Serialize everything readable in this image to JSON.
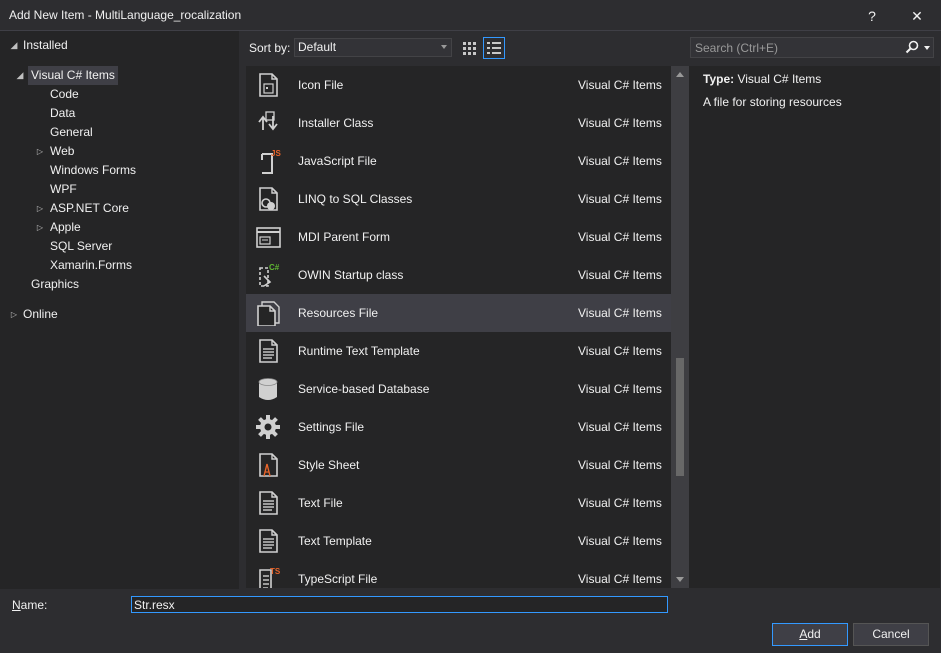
{
  "window": {
    "title": "Add New Item - MultiLanguage_rocalization",
    "help_label": "?",
    "close_label": "✕"
  },
  "tree": {
    "installed": "Installed",
    "visual_cs_items": "Visual C# Items",
    "children": [
      "Code",
      "Data",
      "General",
      "Web",
      "Windows Forms",
      "WPF",
      "ASP.NET Core",
      "Apple",
      "SQL Server",
      "Xamarin.Forms"
    ],
    "graphics": "Graphics",
    "online": "Online"
  },
  "toolbar": {
    "sort_label": "Sort by:",
    "sort_value": "Default"
  },
  "search": {
    "placeholder": "Search (Ctrl+E)"
  },
  "items": [
    {
      "name": "Icon File",
      "category": "Visual C# Items",
      "icon": "icon-file-icon"
    },
    {
      "name": "Installer Class",
      "category": "Visual C# Items",
      "icon": "installer-icon"
    },
    {
      "name": "JavaScript File",
      "category": "Visual C# Items",
      "icon": "javascript-file-icon",
      "badge": "JS"
    },
    {
      "name": "LINQ to SQL Classes",
      "category": "Visual C# Items",
      "icon": "linq-icon"
    },
    {
      "name": "MDI Parent Form",
      "category": "Visual C# Items",
      "icon": "form-icon"
    },
    {
      "name": "OWIN Startup class",
      "category": "Visual C# Items",
      "icon": "owin-icon",
      "badge": "C#"
    },
    {
      "name": "Resources File",
      "category": "Visual C# Items",
      "icon": "resources-file-icon"
    },
    {
      "name": "Runtime Text Template",
      "category": "Visual C# Items",
      "icon": "text-template-icon"
    },
    {
      "name": "Service-based Database",
      "category": "Visual C# Items",
      "icon": "database-icon"
    },
    {
      "name": "Settings File",
      "category": "Visual C# Items",
      "icon": "gear-icon"
    },
    {
      "name": "Style Sheet",
      "category": "Visual C# Items",
      "icon": "stylesheet-icon"
    },
    {
      "name": "Text File",
      "category": "Visual C# Items",
      "icon": "text-file-icon"
    },
    {
      "name": "Text Template",
      "category": "Visual C# Items",
      "icon": "text-template-icon"
    },
    {
      "name": "TypeScript File",
      "category": "Visual C# Items",
      "icon": "typescript-file-icon",
      "badge": "TS"
    }
  ],
  "selected_item": "Resources File",
  "details": {
    "type_label": "Type:",
    "type_value": "Visual C# Items",
    "description": "A file for storing resources"
  },
  "bottom": {
    "name_label_first": "N",
    "name_label_rest": "ame:",
    "name_value": "Str.resx",
    "add_first": "A",
    "add_rest": "dd",
    "cancel_label": "Cancel"
  },
  "colors": {
    "background": "#2d2d30",
    "panel": "#252526",
    "selection": "#3f3f46",
    "accent": "#3399ff",
    "badge_orange": "#e8642a",
    "badge_green": "#5fb832"
  }
}
